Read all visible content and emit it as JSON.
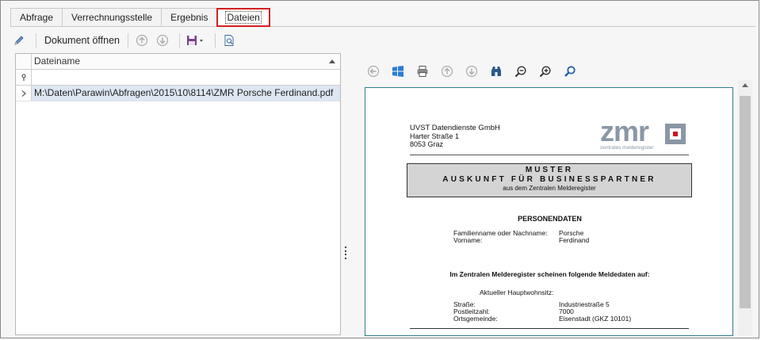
{
  "tabs": [
    {
      "label": "Abfrage",
      "active": false
    },
    {
      "label": "Verrechnungsstelle",
      "active": false
    },
    {
      "label": "Ergebnis",
      "active": false
    },
    {
      "label": "Dateien",
      "active": true
    }
  ],
  "toolbar": {
    "edit_icon": "pencil-icon",
    "open_document_label": "Dokument öffnen",
    "icons": [
      "arrow-up-circle-icon",
      "arrow-down-circle-icon",
      "save-dropdown-icon",
      "preview-icon"
    ]
  },
  "grid": {
    "column_header": "Dateiname",
    "filter_value": "",
    "rows": [
      {
        "filename": "M:\\Daten\\Parawin\\Abfragen\\2015\\10\\8114\\ZMR Porsche Ferdinand.pdf"
      }
    ]
  },
  "viewer_toolbar": {
    "icons": [
      "back-circle-icon",
      "windows-icon",
      "print-icon",
      "page-up-icon",
      "page-down-icon",
      "binoculars-icon",
      "zoom-out-icon",
      "zoom-in-icon",
      "search-icon"
    ]
  },
  "document": {
    "sender_name": "UVST Datendienste GmbH",
    "sender_street": "Harter Straße 1",
    "sender_city": "8053 Graz",
    "logo_text": "zmr",
    "logo_sub": "zentrales melderegister",
    "muster_line1": "MUSTER",
    "muster_line2": "AUSKUNFT FÜR BUSINESSPARTNER",
    "muster_line3": "aus dem Zentralen Melderegister",
    "section_title": "PERSONENDATEN",
    "familienname_label": "Familienname oder Nachname:",
    "familienname_value": "Porsche",
    "vorname_label": "Vorname:",
    "vorname_value": "Ferdinand",
    "lead_text": "Im Zentralen Melderegister scheinen folgende Meldedaten auf:",
    "hauptwohnsitz_label": "Aktueller Hauptwohnsitz:",
    "strasse_label": "Straße:",
    "strasse_value": "Industriestraße 5",
    "plz_label": "Postleitzahl:",
    "plz_value": "7000",
    "ort_label": "Ortsgemeinde:",
    "ort_value": "Eisenstadt (GKZ 10101)"
  },
  "colors": {
    "active_tab_border": "#d42020",
    "selected_row": "#dde7f3",
    "viewer_border": "#2f7d8e",
    "logo_gray": "#8a97a5",
    "logo_red": "#d01020"
  }
}
